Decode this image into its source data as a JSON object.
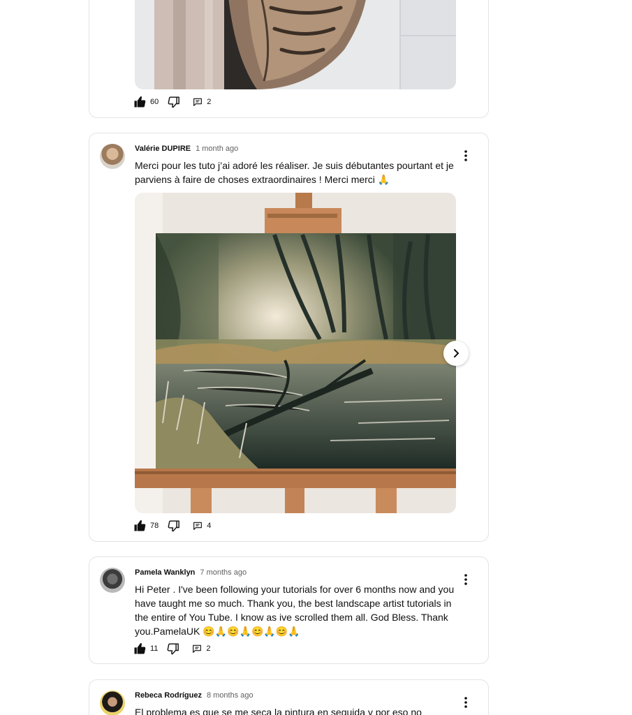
{
  "comments": [
    {
      "likes": "60",
      "replies": "2"
    },
    {
      "author": "Valérie DUPIRE",
      "time": "1 month ago",
      "text": "Merci pour les tuto j’ai adoré les réaliser. Je suis débutantes pourtant et je parviens à faire de choses extraordinaires ! Merci merci 🙏",
      "likes": "78",
      "replies": "4"
    },
    {
      "author": "Pamela Wanklyn",
      "time": "7 months ago",
      "text": "Hi Peter . I've been following your tutorials for over 6 months now and you have taught me so much. Thank you, the best landscape artist tutorials in the entire of You Tube. I know as ive scrolled them all. God Bless. Thank you.PamelaUK 😊🙏😊🙏😊🙏😊🙏",
      "likes": "11",
      "replies": "2"
    },
    {
      "author": "Rebeca Rodríguez",
      "time": "8 months ago",
      "text": "El problema es que se me seca la pintura en seguida y por eso no"
    }
  ],
  "icons": {
    "like": "thumbs-up-icon",
    "dislike": "thumbs-down-icon",
    "reply": "comment-icon",
    "more": "more-vert-icon",
    "next": "chevron-right-icon",
    "gallery": "image-gallery-icon"
  },
  "colors": {
    "border": "#e3e3e3",
    "text": "#0f0f0f",
    "secondary": "#606060"
  }
}
